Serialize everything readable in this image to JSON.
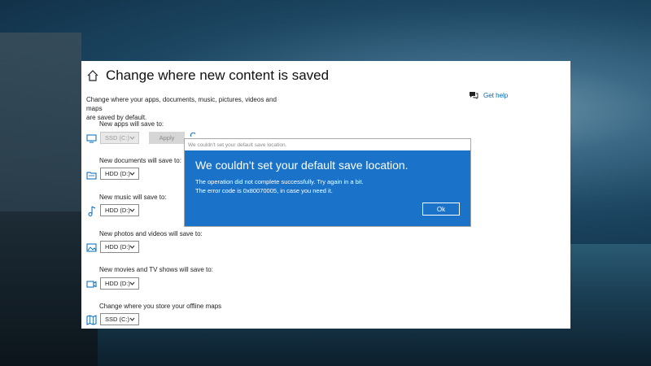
{
  "page": {
    "title": "Change where new content is saved",
    "description_line1": "Change where your apps, documents, music, pictures, videos and maps",
    "description_line2": "are saved by default.",
    "help_label": "Get help"
  },
  "settings": [
    {
      "label": "New apps will save to:",
      "value": "SSD (C:)",
      "icon": "monitor-icon",
      "disabled": true
    },
    {
      "label": "New documents will save to:",
      "value": "HDD (D:)",
      "icon": "folder-icon"
    },
    {
      "label": "New music will save to:",
      "value": "HDD (D:)",
      "icon": "music-note-icon"
    },
    {
      "label": "New photos and videos will save to:",
      "value": "HDD (D:)",
      "icon": "image-icon"
    },
    {
      "label": "New movies and TV shows will save to:",
      "value": "HDD (D:)",
      "icon": "video-camera-icon"
    },
    {
      "label": "Change where you store your offline maps",
      "value": "SSD (C:)",
      "icon": "map-icon"
    }
  ],
  "apply_label": "Apply",
  "dialog": {
    "title_bar": "We couldn't set your default save location.",
    "heading": "We couldn't set your default save location.",
    "message_line1": "The operation did not complete successfully. Try again in a bit.",
    "message_line2": "The error code is 0x80070005, in case you need it.",
    "ok_label": "Ok"
  },
  "colors": {
    "dialog_blue": "#1a73c8",
    "link_blue": "#0067b8"
  }
}
